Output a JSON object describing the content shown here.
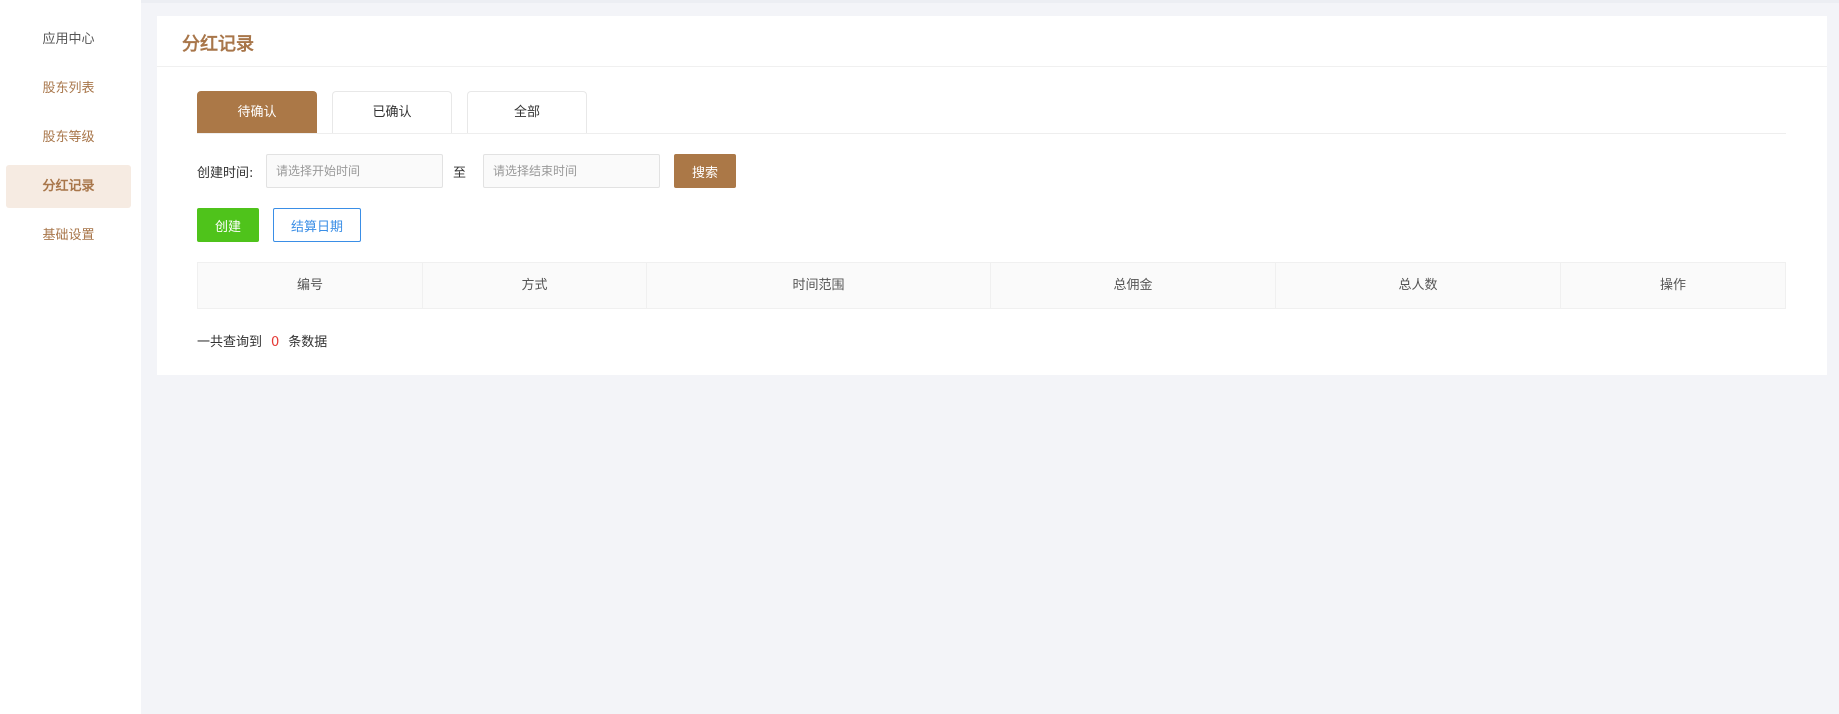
{
  "sidebar": {
    "items": [
      {
        "label": "应用中心"
      },
      {
        "label": "股东列表"
      },
      {
        "label": "股东等级"
      },
      {
        "label": "分红记录"
      },
      {
        "label": "基础设置"
      }
    ]
  },
  "page": {
    "title": "分红记录"
  },
  "tabs": [
    {
      "label": "待确认",
      "active": true
    },
    {
      "label": "已确认",
      "active": false
    },
    {
      "label": "全部",
      "active": false
    }
  ],
  "filter": {
    "created_label": "创建时间:",
    "start_placeholder": "请选择开始时间",
    "to_label": "至",
    "end_placeholder": "请选择结束时间",
    "search_label": "搜索"
  },
  "actions": {
    "create_label": "创建",
    "settle_date_label": "结算日期"
  },
  "table": {
    "columns": [
      "编号",
      "方式",
      "时间范围",
      "总佣金",
      "总人数",
      "操作"
    ],
    "rows": []
  },
  "summary": {
    "prefix": "一共查询到",
    "count": "0",
    "suffix": "条数据"
  },
  "colors": {
    "accent": "#ab7847",
    "create": "#4fc31b",
    "link": "#3a8ee6",
    "count": "#e53935"
  }
}
